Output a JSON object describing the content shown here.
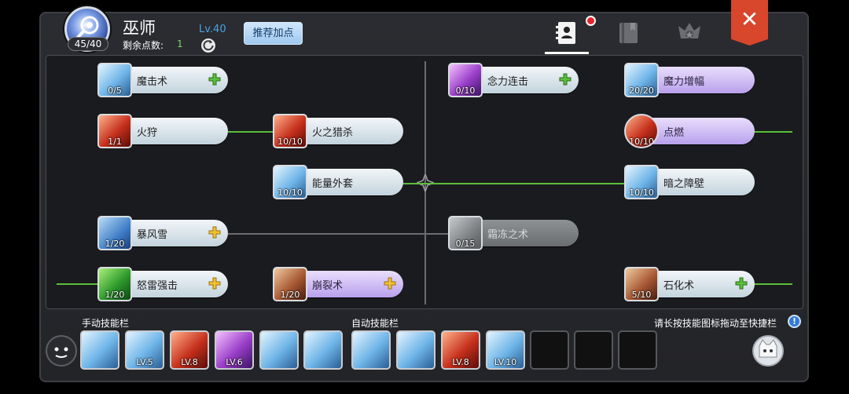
{
  "header": {
    "class_name": "巫师",
    "avatar_count": "45/40",
    "points_label": "剩余点数:",
    "points_value": "1",
    "level": "Lv.40",
    "recommend_button": "推荐加点",
    "tabs": [
      "skill-book-icon",
      "spellbook-icon",
      "emblem-icon"
    ],
    "active_tab": 0,
    "notification_dot": true,
    "close_icon": "close-icon"
  },
  "skills": [
    {
      "name": "魔击术",
      "level": "0/5",
      "icon": "magic-strike-icon",
      "style": "light",
      "plus": "green"
    },
    {
      "name": "火狩",
      "level": "1/1",
      "icon": "fire-hunt-icon",
      "style": "light",
      "plus": ""
    },
    {
      "name": "火之猎杀",
      "level": "10/10",
      "icon": "fire-slaughter-icon",
      "style": "light",
      "plus": ""
    },
    {
      "name": "能量外套",
      "level": "10/10",
      "icon": "energy-coat-icon",
      "style": "light",
      "plus": ""
    },
    {
      "name": "暴风雪",
      "level": "1/20",
      "icon": "blizzard-icon",
      "style": "light",
      "plus": "yellow"
    },
    {
      "name": "怒雷强击",
      "level": "1/20",
      "icon": "thunder-strike-icon",
      "style": "light",
      "plus": "yellow"
    },
    {
      "name": "崩裂术",
      "level": "1/20",
      "icon": "crack-icon",
      "style": "purple",
      "plus": "yellow"
    },
    {
      "name": "念力连击",
      "level": "0/10",
      "icon": "psychic-combo-icon",
      "style": "light",
      "plus": "green"
    },
    {
      "name": "霜冻之术",
      "level": "0/15",
      "icon": "frost-icon",
      "style": "locked",
      "plus": ""
    },
    {
      "name": "魔力增幅",
      "level": "20/20",
      "icon": "mana-boost-icon",
      "style": "purple",
      "plus": ""
    },
    {
      "name": "点燃",
      "level": "10/10",
      "icon": "ignite-icon",
      "style": "purple",
      "plus": ""
    },
    {
      "name": "暗之障壁",
      "level": "10/10",
      "icon": "dark-barrier-icon",
      "style": "light",
      "plus": ""
    },
    {
      "name": "石化术",
      "level": "5/10",
      "icon": "petrify-icon",
      "style": "light",
      "plus": "green"
    }
  ],
  "bottom": {
    "manual_label": "手动技能栏",
    "auto_label": "自动技能栏",
    "hint": "请长按技能图标拖动至快捷栏",
    "manual_slots": [
      {
        "icon": "sword-burst-icon",
        "level": ""
      },
      {
        "icon": "snowflake-icon",
        "level": "LV.5"
      },
      {
        "icon": "fire-explosion-icon",
        "level": "LV.8"
      },
      {
        "icon": "purple-dome-icon",
        "level": "LV.6"
      },
      {
        "icon": "energy-arrows-icon",
        "level": ""
      },
      {
        "icon": "meditate-icon",
        "level": ""
      }
    ],
    "auto_slots": [
      {
        "icon": "sword-burst-icon",
        "level": ""
      },
      {
        "icon": "energy-arrows-icon",
        "level": ""
      },
      {
        "icon": "fire-explosion-icon",
        "level": "LV.8"
      },
      {
        "icon": "vortex-eye-icon",
        "level": "LV.10"
      },
      {
        "icon": "",
        "level": ""
      },
      {
        "icon": "",
        "level": ""
      },
      {
        "icon": "",
        "level": ""
      }
    ],
    "left_face_icon": "emoji-face-icon",
    "right_face_icon": "cat-avatar-icon",
    "info_icon": "!"
  }
}
